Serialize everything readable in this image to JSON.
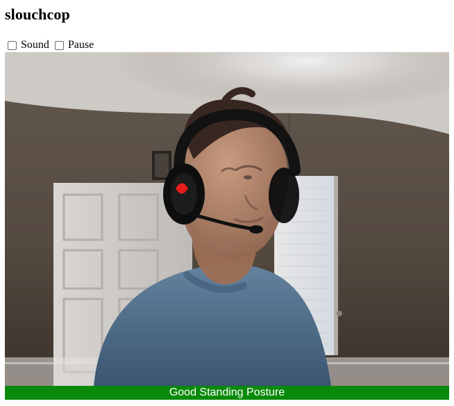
{
  "app": {
    "title": "slouchcop"
  },
  "controls": {
    "sound": {
      "label": "Sound",
      "checked": false
    },
    "pause": {
      "label": "Pause",
      "checked": false
    }
  },
  "video": {
    "icon": "webcam-feed-image"
  },
  "status": {
    "text": "Good Standing Posture",
    "color": "#0a8a0a"
  }
}
